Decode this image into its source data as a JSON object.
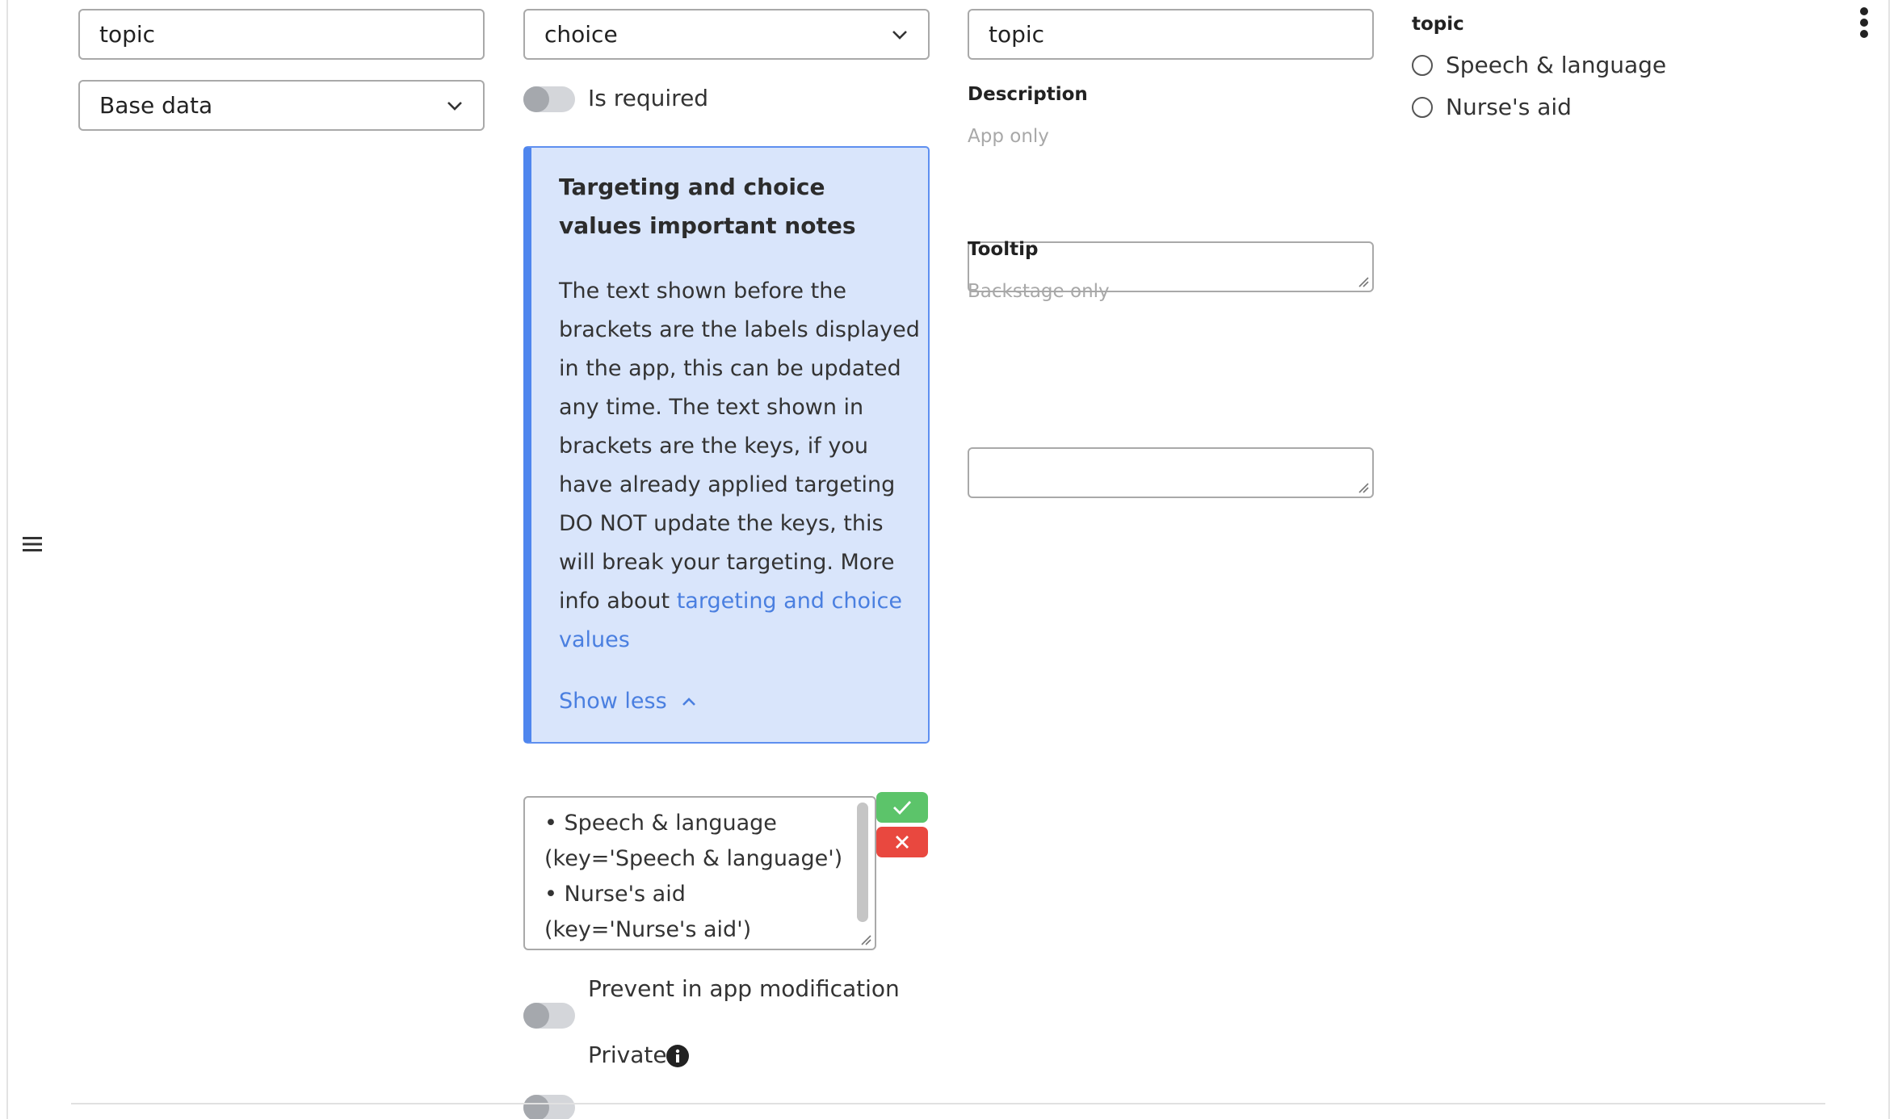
{
  "left_column": {
    "name_input_value": "topic",
    "source_select_value": "Base data"
  },
  "type_column": {
    "type_select_value": "choice",
    "is_required_label": "Is required",
    "notice": {
      "title": "Targeting and choice values important notes",
      "body_prefix": "The text shown before the brackets are the labels displayed in the app, this can be updated any time. The text shown in brackets are the keys, if you have already applied targeting DO NOT update the keys, this will break your targeting. More info about ",
      "link_text": "targeting and choice values",
      "show_less_label": "Show less"
    },
    "choices_text": "• Speech & language (key='Speech & language')\n• Nurse's aid (key='Nurse's aid')",
    "prevent_modification_label": "Prevent in app modification",
    "private_label": "Private"
  },
  "label_column": {
    "label_input_value": "topic",
    "description_label": "Description",
    "description_hint": "App only",
    "tooltip_label": "Tooltip",
    "tooltip_hint": "Backstage only"
  },
  "preview": {
    "title": "topic",
    "options": [
      "Speech & language",
      "Nurse's aid"
    ]
  },
  "colors": {
    "accent_blue": "#4f86ee",
    "notice_bg": "#d9e5fb",
    "confirm_green": "#5cc46a",
    "cancel_red": "#e9483f"
  },
  "icons": {
    "drag_handle": "hamburger-icon",
    "more_menu": "vertical-dots-icon",
    "confirm": "checkmark-icon",
    "cancel": "x-icon",
    "info": "info-icon",
    "dropdown": "chevron-down-icon",
    "collapse": "chevron-up-icon"
  }
}
